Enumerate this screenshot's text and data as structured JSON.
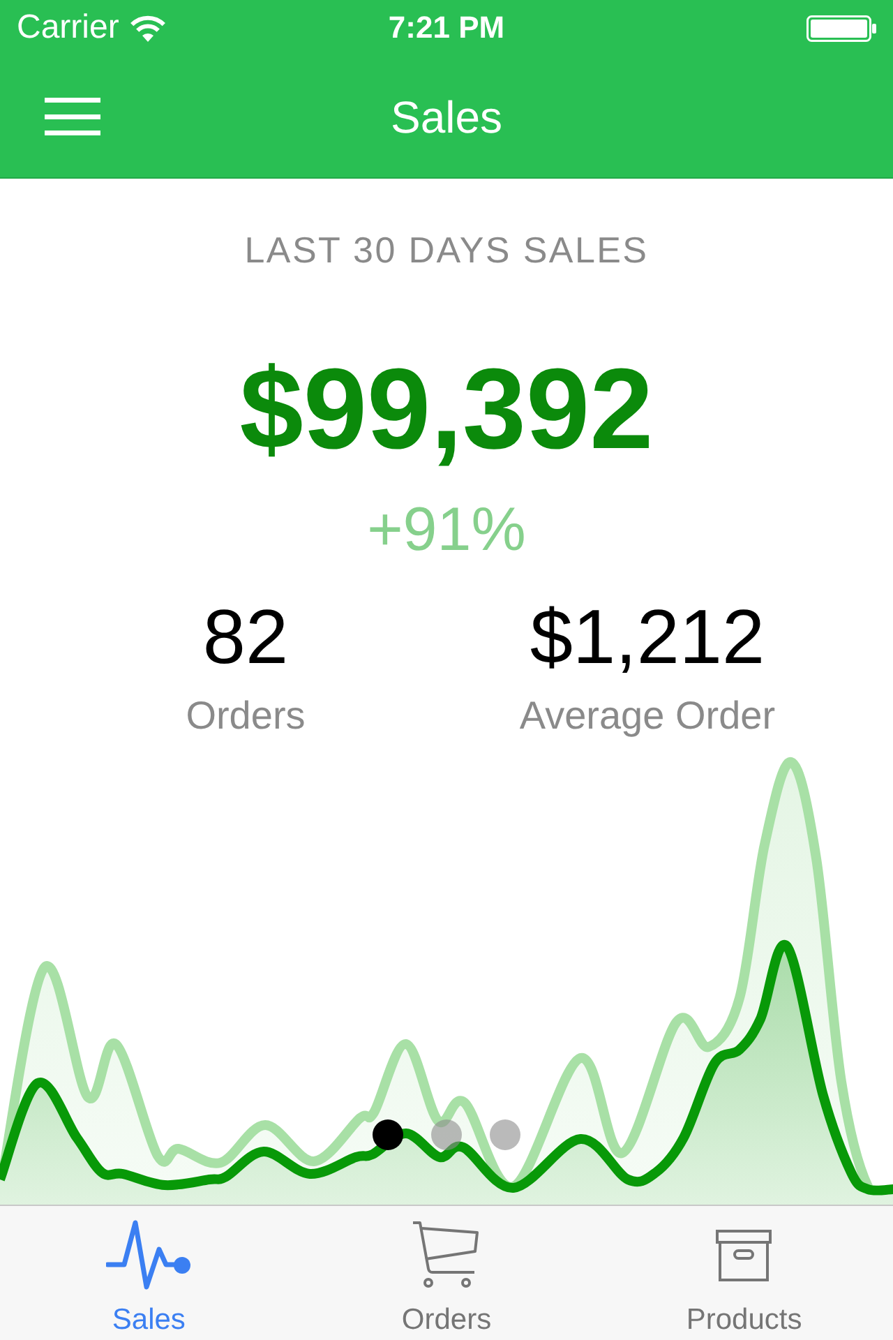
{
  "status_bar": {
    "carrier": "Carrier",
    "time": "7:21 PM"
  },
  "nav_bar": {
    "title": "Sales"
  },
  "summary": {
    "heading": "LAST 30 DAYS SALES",
    "total": "$99,392",
    "change": "+91%"
  },
  "stats": [
    {
      "value": "82",
      "label": "Orders"
    },
    {
      "value": "$1,212",
      "label": "Average Order"
    }
  ],
  "page_dots": [
    {
      "selected": true
    },
    {
      "selected": false
    },
    {
      "selected": false
    }
  ],
  "tabs": [
    {
      "kind": "pulse",
      "label": "Sales",
      "selected": true
    },
    {
      "kind": "cart",
      "label": "Orders",
      "selected": false
    },
    {
      "kind": "box",
      "label": "Products",
      "selected": false
    }
  ]
}
